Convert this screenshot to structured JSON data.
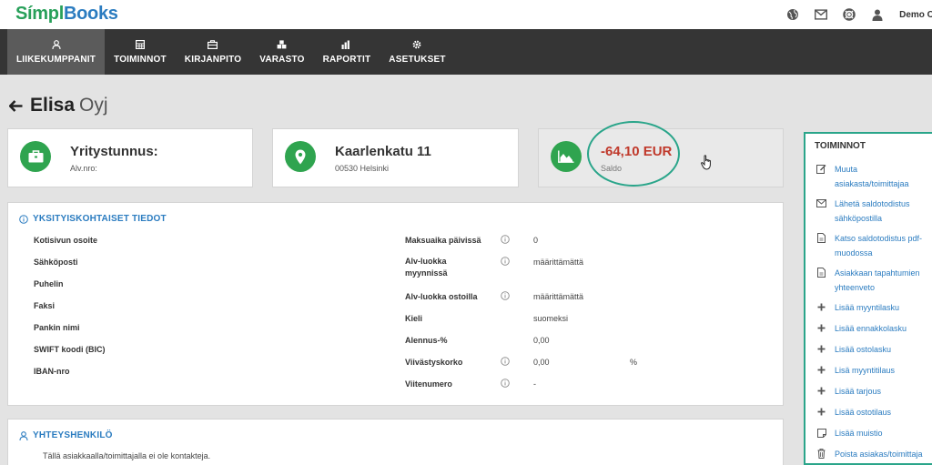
{
  "app": {
    "logo_part1": "Símpl",
    "logo_part2": "Books",
    "user_label": "Demo Oy",
    "brand_green": "#2fa44f",
    "brand_blue": "#2b7cc0"
  },
  "top_icons": [
    "globe-icon",
    "mail-icon",
    "lifebuoy-icon",
    "user-icon"
  ],
  "nav": [
    {
      "label": "LIIKEKUMPPANIT",
      "icon": "person-icon",
      "active": true
    },
    {
      "label": "TOIMINNOT",
      "icon": "calculator-icon"
    },
    {
      "label": "KIRJANPITO",
      "icon": "briefcase-icon"
    },
    {
      "label": "VARASTO",
      "icon": "cubes-icon"
    },
    {
      "label": "RAPORTIT",
      "icon": "bar-chart-icon"
    },
    {
      "label": "ASETUKSET",
      "icon": "gear-icon"
    }
  ],
  "page": {
    "title_main": "Elisa",
    "title_suffix": "Oyj"
  },
  "cards": {
    "company": {
      "title": "Yritystunnus:",
      "sub": "Alv.nro:",
      "icon": "briefcase-icon"
    },
    "address": {
      "title": "Kaarlenkatu 11",
      "sub": "00530 Helsinki",
      "icon": "map-pin-icon"
    },
    "balance": {
      "value": "-64,10 EUR",
      "label": "Saldo",
      "icon": "area-chart-icon",
      "value_color": "#c0392b"
    }
  },
  "details": {
    "header": "YKSITYISKOHTAISET TIEDOT",
    "left_fields": [
      "Kotisivun osoite",
      "Sähköposti",
      "Puhelin",
      "Faksi",
      "Pankin nimi",
      "SWIFT koodi (BIC)",
      "IBAN-nro"
    ],
    "right_fields": [
      {
        "label": "Maksuaika päivissä",
        "value": "0",
        "info": true
      },
      {
        "label": "Alv-luokka myynnissä",
        "value": "määrittämättä",
        "info": true
      },
      {
        "label": "Alv-luokka ostoilla",
        "value": "määrittämättä",
        "info": true
      },
      {
        "label": "Kieli",
        "value": "suomeksi",
        "info": false
      },
      {
        "label": "Alennus-%",
        "value": "0,00",
        "info": false
      },
      {
        "label": "Viivästyskorko",
        "value": "0,00",
        "unit": "%",
        "info": true
      },
      {
        "label": "Viitenumero",
        "value": "-",
        "info": true
      }
    ]
  },
  "contacts": {
    "header": "YHTEYSHENKILÖ",
    "empty_text": "Tällä asiakkaalla/toimittajalla ei ole kontakteja."
  },
  "actions": {
    "title": "TOIMINNOT",
    "items": [
      {
        "label": "Muuta asiakasta/toimittajaa",
        "icon": "edit-icon"
      },
      {
        "label": "Lähetä saldotodistus sähköpostilla",
        "icon": "envelope-icon"
      },
      {
        "label": "Katso saldotodistus pdf-muodossa",
        "icon": "file-icon"
      },
      {
        "label": "Asiakkaan tapahtumien yhteenveto",
        "icon": "file-icon"
      },
      {
        "label": "Lisää myyntilasku",
        "icon": "plus-icon"
      },
      {
        "label": "Lisää ennakkolasku",
        "icon": "plus-icon"
      },
      {
        "label": "Lisää ostolasku",
        "icon": "plus-icon"
      },
      {
        "label": "Lisä myyntitilaus",
        "icon": "plus-icon"
      },
      {
        "label": "Lisää tarjous",
        "icon": "plus-icon"
      },
      {
        "label": "Lisää ostotilaus",
        "icon": "plus-icon"
      },
      {
        "label": "Lisää muistio",
        "icon": "note-icon"
      },
      {
        "label": "Poista asiakas/toimittaja",
        "icon": "trash-icon"
      }
    ]
  }
}
